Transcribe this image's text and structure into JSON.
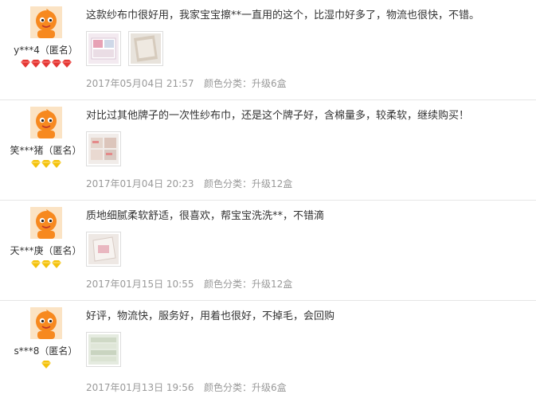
{
  "colors": {
    "avatar_orange": "#f7891f",
    "gem_red": "#e53935",
    "gem_yellow": "#f4c20d",
    "meta_gray": "#999999",
    "text": "#333333"
  },
  "sku_label": "颜色分类：",
  "reviews": [
    {
      "username": "y***4（匿名）",
      "rank_icon": "red-diamond-icon",
      "rank_count": 5,
      "text": "这款纱布巾很好用，我家宝宝擦**一直用的这个，比湿巾好多了，物流也很快，不错。",
      "photo_count": 2,
      "date": "2017年05月04日 21:57",
      "sku": "升级6盒"
    },
    {
      "username": "笑***猪（匿名）",
      "rank_icon": "yellow-diamond-icon",
      "rank_count": 3,
      "text": "对比过其他牌子的一次性纱布巾，还是这个牌子好，含棉量多，较柔软，继续购买！",
      "photo_count": 1,
      "date": "2017年01月04日 20:23",
      "sku": "升级12盒"
    },
    {
      "username": "天***庚（匿名）",
      "rank_icon": "yellow-diamond-icon",
      "rank_count": 3,
      "text": "质地细腻柔软舒适，很喜欢，帮宝宝洗洗**，不错滴",
      "photo_count": 1,
      "date": "2017年01月15日 10:55",
      "sku": "升级12盒"
    },
    {
      "username": "s***8（匿名）",
      "rank_icon": "yellow-diamond-icon",
      "rank_count": 1,
      "text": "好评，物流快，服务好，用着也很好，不掉毛，会回购",
      "photo_count": 1,
      "date": "2017年01月13日 19:56",
      "sku": "升级6盒"
    }
  ]
}
